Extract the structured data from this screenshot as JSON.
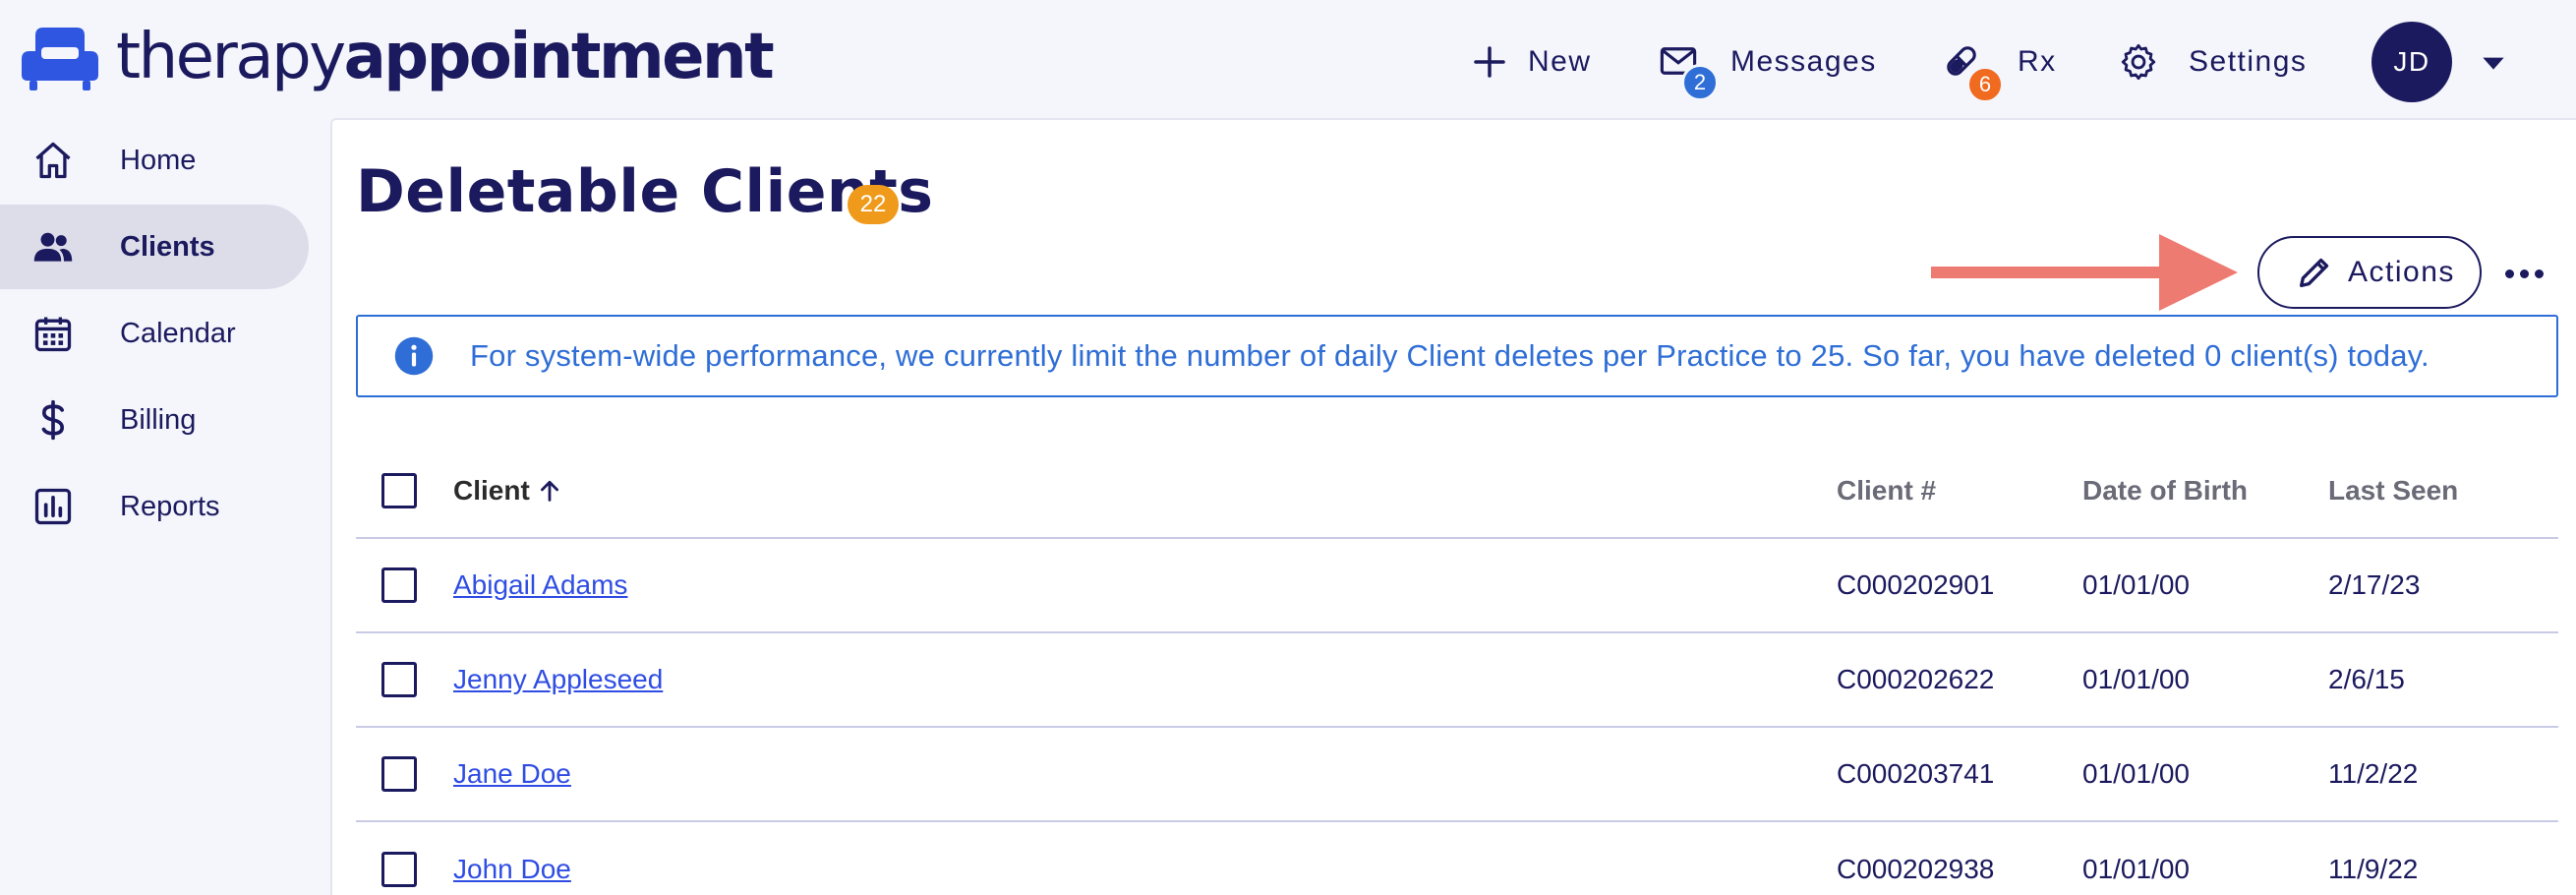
{
  "app": {
    "logo_text_light": "therapy",
    "logo_text_bold": "appointment",
    "brand_color": "#1c1a5e",
    "logo_icon": "couch-icon"
  },
  "topnav": {
    "new_label": "New",
    "messages_label": "Messages",
    "messages_count": "2",
    "rx_label": "Rx",
    "rx_count": "6",
    "settings_label": "Settings",
    "avatar_initials": "JD"
  },
  "sidebar": {
    "items": [
      {
        "label": "Home",
        "icon": "home-icon"
      },
      {
        "label": "Clients",
        "icon": "users-icon",
        "active": true
      },
      {
        "label": "Calendar",
        "icon": "calendar-icon"
      },
      {
        "label": "Billing",
        "icon": "dollar-icon"
      },
      {
        "label": "Reports",
        "icon": "chart-icon"
      }
    ]
  },
  "page": {
    "title": "Deletable Clients",
    "count": "22",
    "actions_label": "Actions",
    "info_text": "For system-wide performance, we currently limit the number of daily Client deletes per Practice to 25. So far, you have deleted 0 client(s) today."
  },
  "table": {
    "headers": {
      "client": "Client",
      "client_num": "Client #",
      "dob": "Date of Birth",
      "last_seen": "Last Seen"
    },
    "rows": [
      {
        "name": "Abigail Adams",
        "num": "C000202901",
        "dob": "01/01/00",
        "seen": "2/17/23"
      },
      {
        "name": "Jenny Appleseed",
        "num": "C000202622",
        "dob": "01/01/00",
        "seen": "2/6/15"
      },
      {
        "name": "Jane Doe",
        "num": "C000203741",
        "dob": "01/01/00",
        "seen": "11/2/22"
      },
      {
        "name": "John Doe",
        "num": "C000202938",
        "dob": "01/01/00",
        "seen": "11/9/22"
      }
    ]
  },
  "colors": {
    "accent_blue": "#2f6ed6",
    "badge_orange": "#f06a1f",
    "count_badge": "#ef9a1a",
    "annotation_arrow": "#ee7b72"
  }
}
